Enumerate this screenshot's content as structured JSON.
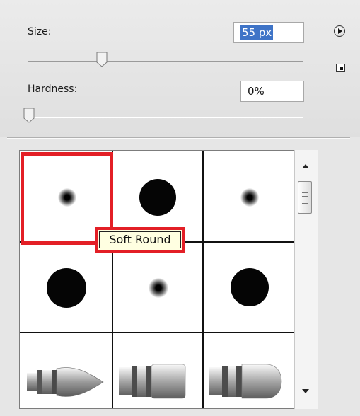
{
  "size": {
    "label": "Size:",
    "value": "55 px"
  },
  "hardness": {
    "label": "Hardness:",
    "value": "0%"
  },
  "icons": {
    "menu": "flyout-menu-icon",
    "new_preset": "create-new-preset-icon"
  },
  "brushes": [
    {
      "kind": "soft-round",
      "name": "Soft Round",
      "selected": true
    },
    {
      "kind": "hard-round"
    },
    {
      "kind": "soft-round"
    },
    {
      "kind": "hard-round"
    },
    {
      "kind": "soft-round"
    },
    {
      "kind": "hard-round"
    },
    {
      "kind": "bristle-point"
    },
    {
      "kind": "bristle-flat"
    },
    {
      "kind": "bristle-round"
    }
  ],
  "tooltip": "Soft Round",
  "colors": {
    "highlight": "#e31f26",
    "selection": "#3f74c7"
  }
}
